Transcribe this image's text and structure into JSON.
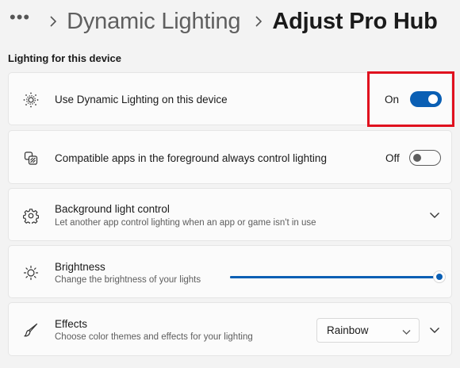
{
  "breadcrumb": {
    "more": "•••",
    "parent": "Dynamic Lighting",
    "current": "Adjust Pro Hub"
  },
  "section_title": "Lighting for this device",
  "settings": {
    "use_dynamic_lighting": {
      "label": "Use Dynamic Lighting on this device",
      "state_label": "On",
      "enabled": true,
      "icon": "dynamic-lighting-icon"
    },
    "compatible_apps": {
      "label": "Compatible apps in the foreground always control lighting",
      "state_label": "Off",
      "enabled": false,
      "icon": "apps-lighting-icon"
    },
    "background_control": {
      "label": "Background light control",
      "description": "Let another app control lighting when an app or game isn't in use",
      "icon": "gear-icon"
    },
    "brightness": {
      "label": "Brightness",
      "description": "Change the brightness of your lights",
      "value_percent": 100,
      "icon": "sun-icon"
    },
    "effects": {
      "label": "Effects",
      "description": "Choose color themes and effects for your lighting",
      "selected": "Rainbow",
      "icon": "brush-icon"
    }
  },
  "colors": {
    "accent": "#0a5fb4",
    "highlight": "#e0101e"
  }
}
